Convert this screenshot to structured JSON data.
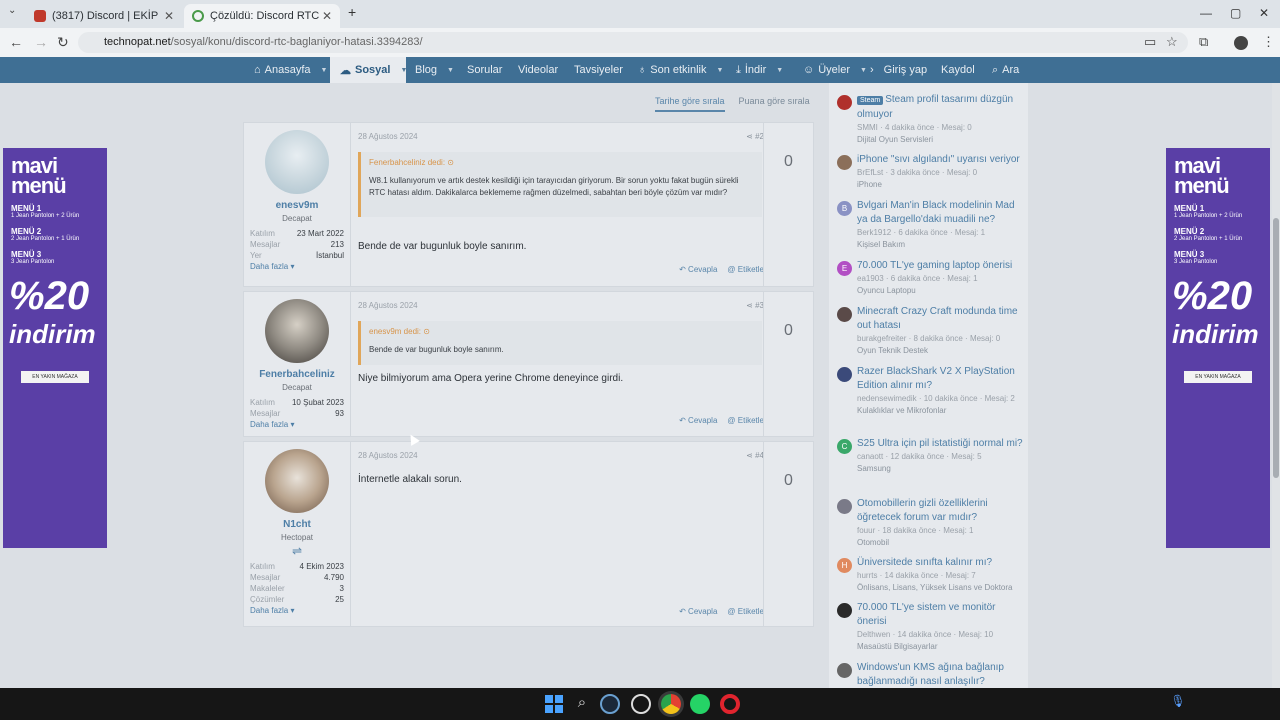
{
  "browser": {
    "tabs": [
      {
        "title": "(3817) Discord | EKİP",
        "active": false
      },
      {
        "title": "Çözüldü: Discord RTC bağlanıy...",
        "active": true
      }
    ],
    "url_host": "technopat.net",
    "url_path": "/sosyal/konu/discord-rtc-baglaniyor-hatasi.3394283/"
  },
  "nav": {
    "items": [
      "Anasayfa",
      "Sosyal",
      "Blog",
      "Sorular",
      "Videolar",
      "Tavsiyeler",
      "Son etkinlik",
      "İndir",
      "Üyeler",
      "Giriş yap",
      "Kaydol",
      "Ara"
    ]
  },
  "sort": {
    "tabs": [
      "Tarihe göre sırala",
      "Puana göre sırala"
    ]
  },
  "posts": [
    {
      "user": "enesv9m",
      "title": "Decapat",
      "stats": [
        [
          "Katılım",
          "23 Mart 2022"
        ],
        [
          "Mesajlar",
          "213"
        ],
        [
          "Yer",
          "İstanbul"
        ]
      ],
      "more": "Daha fazla",
      "date": "28 Ağustos 2024",
      "num": "#2",
      "quote_head": "Fenerbahceliniz dedi:",
      "quote_text": "W8.1 kullanıyorum ve artık destek kesildiği için tarayıcıdan giriyorum. Bir sorun yoktu fakat bugün sürekli RTC hatası aldım. Dakikalarca beklememe rağmen düzelmedi, sabahtan beri böyle çözüm var mıdır?",
      "text": "Bende de var bugunluk boyle sanırım.",
      "reply": "Cevapla",
      "tag": "Etiketle",
      "votes": "0"
    },
    {
      "user": "Fenerbahceliniz",
      "title": "Decapat",
      "stats": [
        [
          "Katılım",
          "10 Şubat 2023"
        ],
        [
          "Mesajlar",
          "93"
        ]
      ],
      "more": "Daha fazla",
      "date": "28 Ağustos 2024",
      "num": "#3",
      "quote_head": "enesv9m dedi:",
      "quote_text": "Bende de var bugunluk boyle sanırım.",
      "text": "Niye bilmiyorum ama Opera yerine Chrome deneyince girdi.",
      "reply": "Cevapla",
      "tag": "Etiketle",
      "votes": "0"
    },
    {
      "user": "N1cht",
      "title": "Hectopat",
      "stats": [
        [
          "Katılım",
          "4 Ekim 2023"
        ],
        [
          "Mesajlar",
          "4.790"
        ],
        [
          "Makaleler",
          "3"
        ],
        [
          "Çözümler",
          "25"
        ]
      ],
      "more": "Daha fazla",
      "date": "28 Ağustos 2024",
      "num": "#4",
      "text": "İnternetle alakalı sorun.",
      "reply": "Cevapla",
      "tag": "Etiketle",
      "votes": "0"
    }
  ],
  "ad": {
    "brand1": "mavi",
    "brand2": "menü",
    "menus": [
      [
        "MENÜ 1",
        "1 Jean Pantolon + 2 Ürün"
      ],
      [
        "MENÜ 2",
        "2 Jean Pantolon + 1 Ürün"
      ],
      [
        "MENÜ 3",
        "3 Jean Pantolon"
      ]
    ],
    "big1": "%20",
    "big2": "indirim",
    "cta": "EN YAKIN MAĞAZA"
  },
  "sidebar": [
    {
      "badge": "Steam",
      "title": "Steam profil tasarımı düzgün olmuyor",
      "meta": "SMMI · 4 dakika önce · Mesaj: 0",
      "cat": "Dijital Oyun Servisleri",
      "color": "#b0302c"
    },
    {
      "title": "iPhone \"sıvı algılandı\" uyarısı veriyor",
      "meta": "BrEfLst · 3 dakika önce · Mesaj: 0",
      "cat": "iPhone",
      "color": "#8b6f5a"
    },
    {
      "title": "Bvlgari Man'in Black modelinin Mad ya da Bargello'daki muadili ne?",
      "meta": "Berk1912 · 6 dakika önce · Mesaj: 1",
      "cat": "Kişisel Bakım",
      "color": "#8a92c4",
      "letter": "B"
    },
    {
      "title": "70.000 TL'ye gaming laptop önerisi",
      "meta": "ea1903 · 6 dakika önce · Mesaj: 1",
      "cat": "Oyuncu Laptopu",
      "color": "#b24fc4",
      "letter": "E"
    },
    {
      "title": "Minecraft Crazy Craft modunda time out hatası",
      "meta": "burakgefreiter · 8 dakika önce · Mesaj: 0",
      "cat": "Oyun Teknik Destek",
      "color": "#5a4a48"
    },
    {
      "title": "Razer BlackShark V2 X PlayStation Edition alınır mı?",
      "meta": "nedensewimedik · 10 dakika önce · Mesaj: 2",
      "cat": "Kulaklıklar ve Mikrofonlar",
      "color": "#3b4a7a"
    },
    {
      "title": "S25 Ultra için pil istatistiği normal mi?",
      "meta": "canaott · 12 dakika önce · Mesaj: 5",
      "cat": "Samsung",
      "color": "#3aa86a",
      "letter": "C"
    },
    {
      "title": "Otomobillerin gizli özelliklerini öğretecek forum var mıdır?",
      "meta": "fouur · 18 dakika önce · Mesaj: 1",
      "cat": "Otomobil",
      "color": "#7a7a88"
    },
    {
      "title": "Üniversitede sınıfta kalınır mı?",
      "meta": "hurrts · 14 dakika önce · Mesaj: 7",
      "cat": "Önlisans, Lisans, Yüksek Lisans ve Doktora",
      "color": "#e08a60",
      "letter": "H"
    },
    {
      "title": "70.000 TL'ye sistem ve monitör önerisi",
      "meta": "Delthwen · 14 dakika önce · Mesaj: 10",
      "cat": "Masaüstü Bilgisayarlar",
      "color": "#2a2a2a"
    },
    {
      "title": "Windows'un KMS ağına bağlanıp bağlanmadığı nasıl anlaşılır?",
      "meta": "",
      "cat": "",
      "color": "#666"
    }
  ]
}
